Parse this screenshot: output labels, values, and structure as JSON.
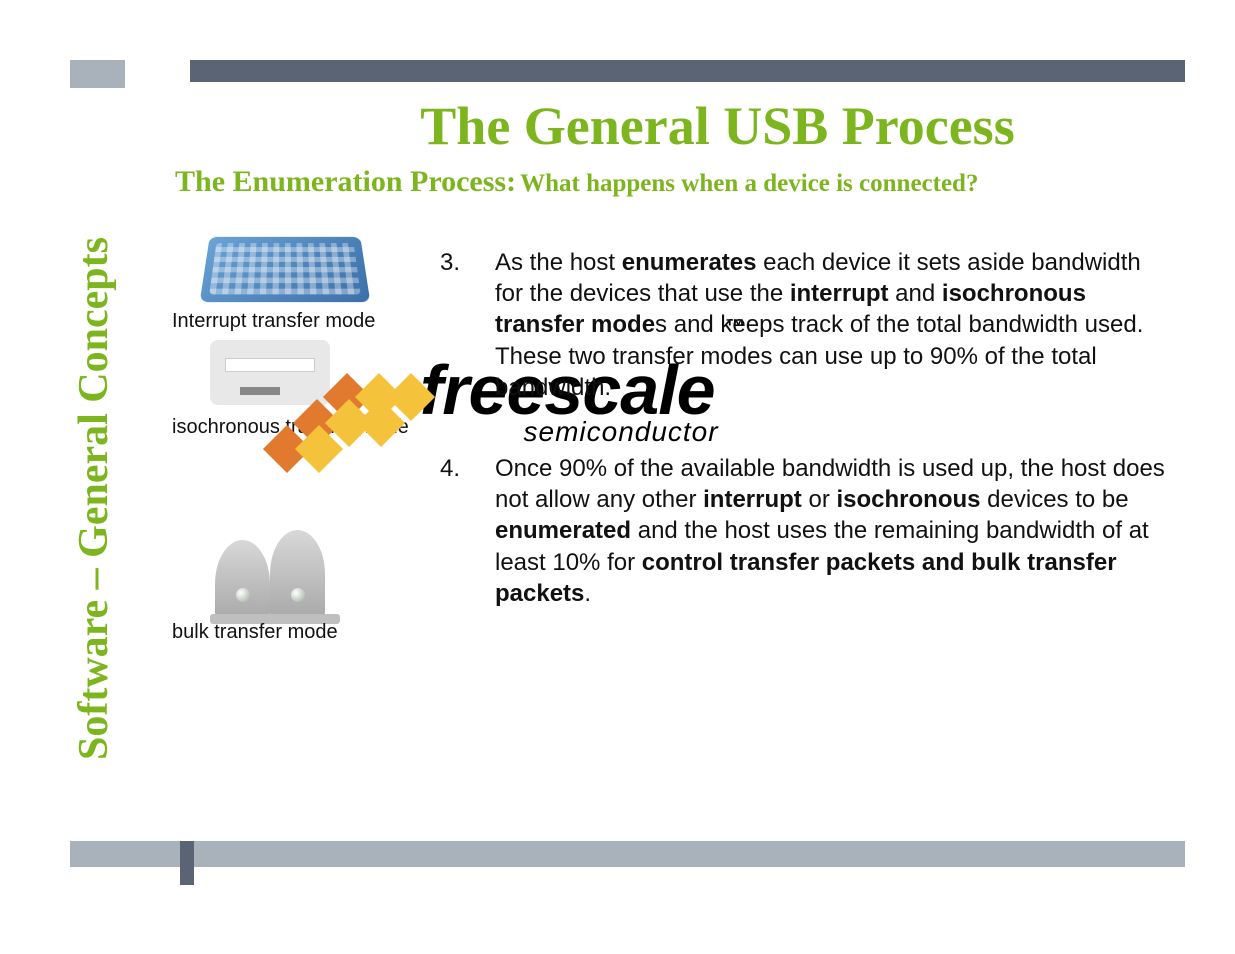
{
  "side_title": "Software – General Concepts",
  "title": "The General USB Process",
  "subtitle_a": "The Enumeration Process:",
  "subtitle_b": "What happens when a device is connected?",
  "labels": {
    "interrupt": "Interrupt transfer mode",
    "isochronous": "isochronous transfer mode",
    "bulk": "bulk transfer mode"
  },
  "items": [
    {
      "num": "3.",
      "segments": [
        {
          "t": "As the host "
        },
        {
          "t": "enumerates",
          "b": true
        },
        {
          "t": " each device it sets aside bandwidth for the devices that use the "
        },
        {
          "t": "interrupt",
          "b": true
        },
        {
          "t": " and "
        },
        {
          "t": "isochronous transfer mode",
          "b": true
        },
        {
          "t": "s and keeps track of the total bandwidth used. These two transfer modes can use up to 90% of the total bandwidth."
        }
      ]
    },
    {
      "num": "4.",
      "segments": [
        {
          "t": "Once 90% of the available bandwidth is used up, the host does not allow any other "
        },
        {
          "t": "interrupt",
          "b": true
        },
        {
          "t": " or "
        },
        {
          "t": "isochronous",
          "b": true
        },
        {
          "t": " devices to be "
        },
        {
          "t": "enumerated",
          "b": true
        },
        {
          "t": " and the host uses the remaining bandwidth of at least 10% for "
        },
        {
          "t": "control transfer packets and bulk transfer packets",
          "b": true
        },
        {
          "t": "."
        }
      ]
    }
  ],
  "watermark": {
    "brand": "freescale",
    "tm": "™",
    "sub": "semiconductor"
  }
}
